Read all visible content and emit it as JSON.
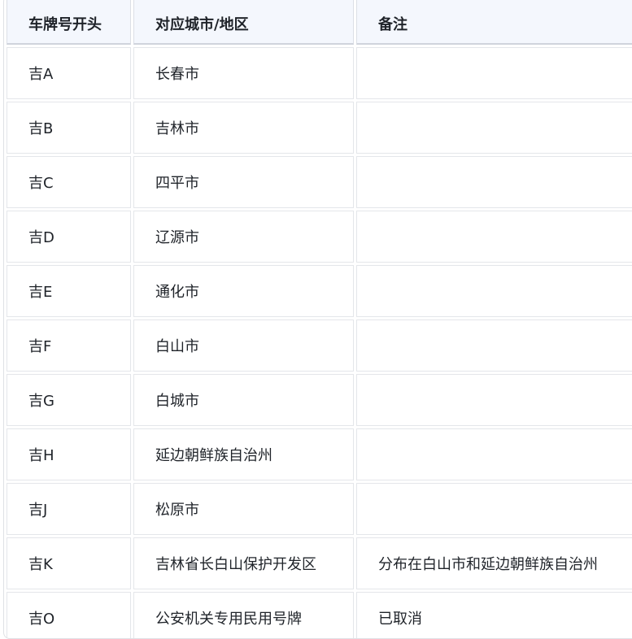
{
  "table": {
    "headers": [
      "车牌号开头",
      "对应城市/地区",
      "备注"
    ],
    "rows": [
      {
        "prefix": "吉A",
        "city": "长春市",
        "note": ""
      },
      {
        "prefix": "吉B",
        "city": "吉林市",
        "note": ""
      },
      {
        "prefix": "吉C",
        "city": "四平市",
        "note": ""
      },
      {
        "prefix": "吉D",
        "city": "辽源市",
        "note": ""
      },
      {
        "prefix": "吉E",
        "city": "通化市",
        "note": ""
      },
      {
        "prefix": "吉F",
        "city": "白山市",
        "note": ""
      },
      {
        "prefix": "吉G",
        "city": "白城市",
        "note": ""
      },
      {
        "prefix": "吉H",
        "city": "延边朝鲜族自治州",
        "note": ""
      },
      {
        "prefix": "吉J",
        "city": "松原市",
        "note": ""
      },
      {
        "prefix": "吉K",
        "city": "吉林省长白山保护开发区",
        "note": "分布在白山市和延边朝鲜族自治州"
      },
      {
        "prefix": "吉O",
        "city": "公安机关专用民用号牌",
        "note": "已取消"
      }
    ]
  }
}
